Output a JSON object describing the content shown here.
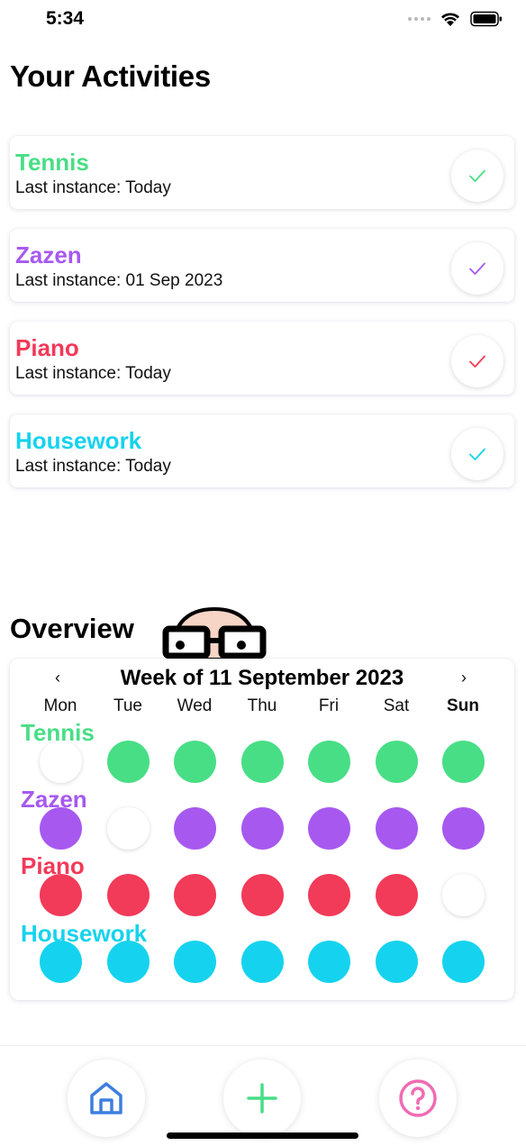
{
  "status_bar": {
    "time": "5:34"
  },
  "page_title": "Your Activities",
  "activities": [
    {
      "name": "Tennis",
      "last_instance": "Last instance: Today",
      "color": "#48DE86"
    },
    {
      "name": "Zazen",
      "last_instance": "Last instance: 01 Sep 2023",
      "color": "#A759EF"
    },
    {
      "name": "Piano",
      "last_instance": "Last instance: Today",
      "color": "#F23A59"
    },
    {
      "name": "Housework",
      "last_instance": "Last instance: Today",
      "color": "#15D3EE"
    }
  ],
  "overview": {
    "title": "Overview",
    "week_label": "Week of 11 September 2023",
    "prev": "‹",
    "next": "›",
    "days": [
      "Mon",
      "Tue",
      "Wed",
      "Thu",
      "Fri",
      "Sat",
      "Sun"
    ],
    "current_day": "Sun",
    "grid": [
      [
        false,
        true,
        true,
        true,
        true,
        true,
        true
      ],
      [
        true,
        false,
        true,
        true,
        true,
        true,
        true
      ],
      [
        true,
        true,
        true,
        true,
        true,
        true,
        false
      ],
      [
        true,
        true,
        true,
        true,
        true,
        true,
        true
      ]
    ]
  },
  "tab_bar": {
    "items": [
      {
        "icon": "home-icon",
        "color": "#3D7FE0"
      },
      {
        "icon": "plus-icon",
        "color": "#48DE86"
      },
      {
        "icon": "help-icon",
        "color": "#F06BB3"
      }
    ]
  }
}
